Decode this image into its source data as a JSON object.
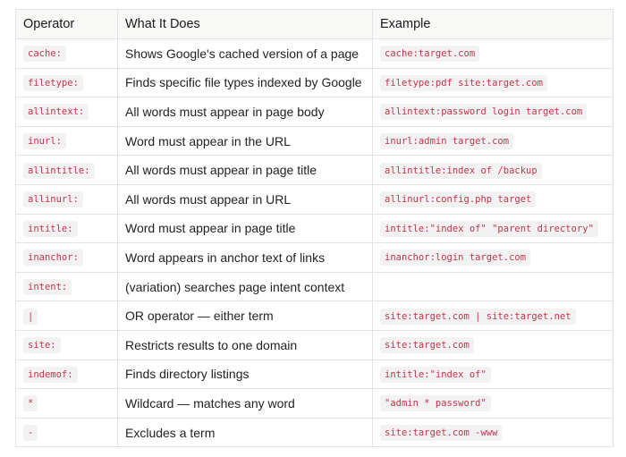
{
  "table": {
    "headers": [
      "Operator",
      "What It Does",
      "Example"
    ],
    "rows": [
      {
        "operator": "cache:",
        "description": "Shows Google's cached version of a page",
        "example": "cache:target.com"
      },
      {
        "operator": "filetype:",
        "description": "Finds specific file types indexed by Google",
        "example": "filetype:pdf site:target.com"
      },
      {
        "operator": "allintext:",
        "description": "All words must appear in page body",
        "example": "allintext:password login target.com"
      },
      {
        "operator": "inurl:",
        "description": "Word must appear in the URL",
        "example": "inurl:admin target.com"
      },
      {
        "operator": "allintitle:",
        "description": "All words must appear in page title",
        "example": "allintitle:index of /backup"
      },
      {
        "operator": "allinurl:",
        "description": "All words must appear in URL",
        "example": "allinurl:config.php target"
      },
      {
        "operator": "intitle:",
        "description": "Word must appear in page title",
        "example": "intitle:\"index of\" \"parent directory\""
      },
      {
        "operator": "inanchor:",
        "description": "Word appears in anchor text of links",
        "example": "inanchor:login target.com"
      },
      {
        "operator": "intent:",
        "description": "(variation) searches page intent context",
        "example": ""
      },
      {
        "operator": "|",
        "description": "OR operator — either term",
        "example": "site:target.com | site:target.net"
      },
      {
        "operator": "site:",
        "description": "Restricts results to one domain",
        "example": "site:target.com"
      },
      {
        "operator": "indemof:",
        "description": "Finds directory listings",
        "example": "intitle:\"index of\""
      },
      {
        "operator": "*",
        "description": "Wildcard — matches any word",
        "example": "\"admin * password\""
      },
      {
        "operator": "-",
        "description": "Excludes a term",
        "example": "site:target.com -www"
      }
    ]
  },
  "colors": {
    "code_text": "#c7344b",
    "code_background": "#f2f2f2",
    "header_background": "#f8f8f6",
    "border": "#e3e3e3"
  }
}
